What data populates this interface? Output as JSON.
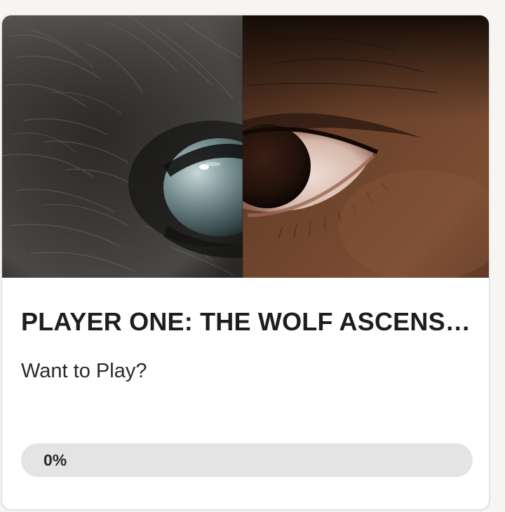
{
  "card": {
    "title": "PLAYER ONE: THE WOLF ASCENSION",
    "subtitle": "Want to Play?",
    "progress": {
      "label": "0%",
      "value": 0
    },
    "cover_image": "split-face-eye-wolf-human"
  },
  "colors": {
    "card_background": "#ffffff",
    "page_background": "#f6f5f3",
    "progress_track": "#e4e4e4",
    "title_text": "#1e1e1e"
  }
}
